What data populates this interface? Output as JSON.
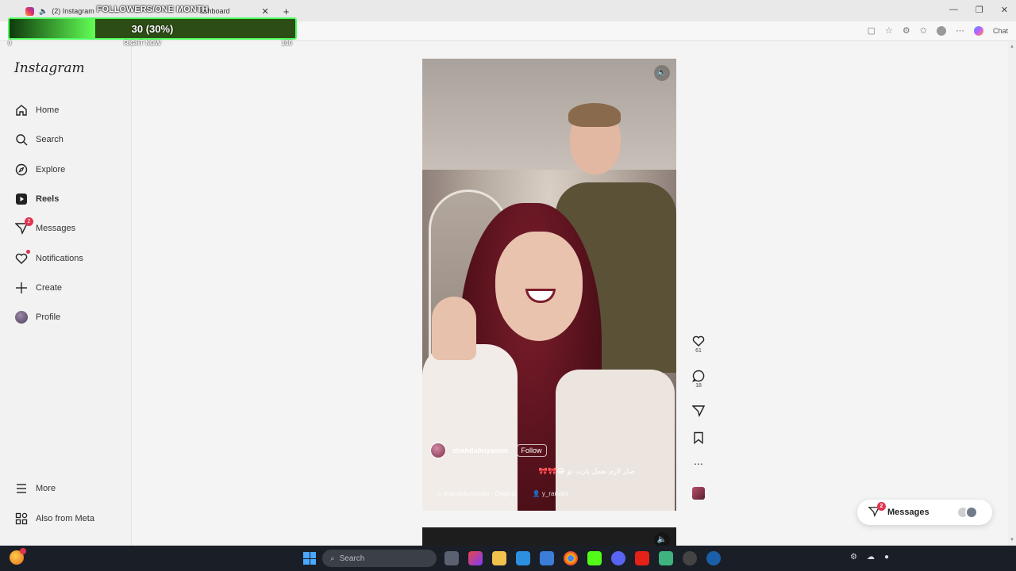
{
  "browser": {
    "tabs": [
      {
        "label": "(2) Instagram"
      },
      {
        "label": "ashboard"
      }
    ],
    "chat_label": "Chat"
  },
  "overlay": {
    "title": "FOLLOWERS/ONE MONTH",
    "value_text": "30 (30%)",
    "progress": 0.3,
    "min_label": "0",
    "mid_label": "RIGHT NOW",
    "max_label": "100"
  },
  "sidebar": {
    "logo": "Instagram",
    "items": [
      {
        "label": "Home",
        "icon": "home-icon"
      },
      {
        "label": "Search",
        "icon": "search-icon"
      },
      {
        "label": "Explore",
        "icon": "compass-icon"
      },
      {
        "label": "Reels",
        "icon": "reels-icon"
      },
      {
        "label": "Messages",
        "icon": "messenger-icon",
        "badge": "2"
      },
      {
        "label": "Notifications",
        "icon": "heart-icon"
      },
      {
        "label": "Create",
        "icon": "plus-icon"
      },
      {
        "label": "Profile",
        "icon": "avatar"
      }
    ],
    "footer": [
      {
        "label": "More",
        "icon": "menu-icon"
      },
      {
        "label": "Also from Meta",
        "icon": "meta-icon"
      }
    ]
  },
  "reel": {
    "username": "shahdabuyassin",
    "follow_label": "Follow",
    "caption": "صار لازم نعمل بارت تو 😂🎀🎀",
    "audio": "shahdabuyassin · Original",
    "tagged_user": "y_ramahi",
    "likes": "61",
    "comments": "18"
  },
  "messages_pill": {
    "label": "Messages",
    "badge": "2"
  },
  "taskbar": {
    "search_placeholder": "Search"
  }
}
